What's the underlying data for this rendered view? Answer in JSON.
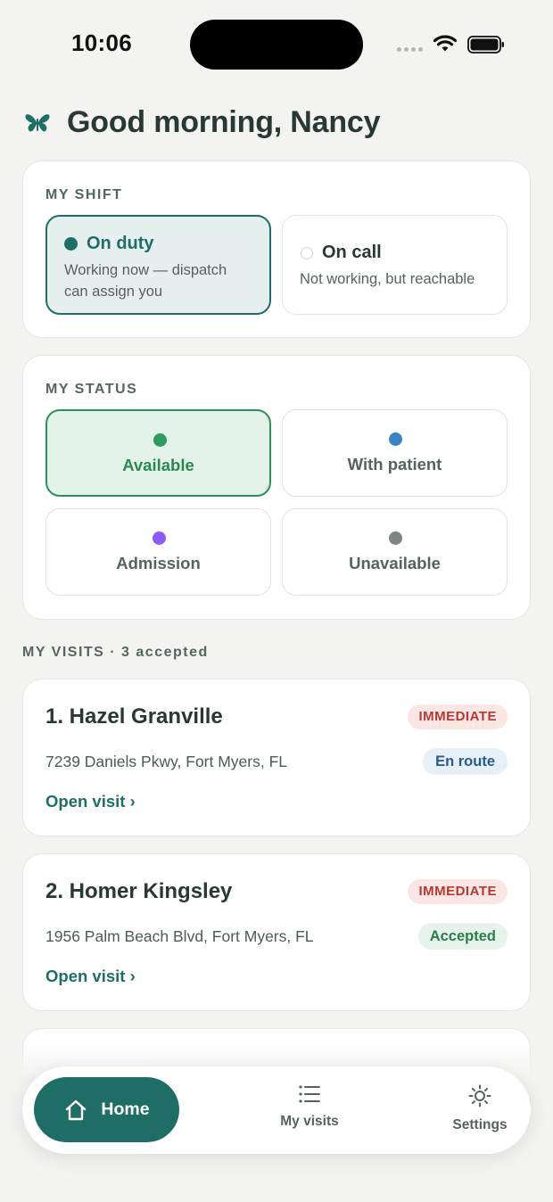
{
  "status_bar": {
    "time": "10:06"
  },
  "header": {
    "greeting": "Good morning, Nancy"
  },
  "shift": {
    "label": "MY SHIFT",
    "options": [
      {
        "title": "On duty",
        "subtitle_line1": "Working now — dispatch",
        "subtitle_line2": "can assign you",
        "selected": true
      },
      {
        "title": "On call",
        "subtitle_line1": "Not working, but reachable",
        "selected": false
      }
    ]
  },
  "status": {
    "label": "MY STATUS",
    "options": [
      {
        "label": "Available",
        "color": "#2e9a5c",
        "selected": true
      },
      {
        "label": "With patient",
        "color": "#3b82c4",
        "selected": false
      },
      {
        "label": "Admission",
        "color": "#8b5cf6",
        "selected": false
      },
      {
        "label": "Unavailable",
        "color": "#7d8583",
        "selected": false
      }
    ]
  },
  "visits": {
    "label": "MY VISITS · 3 accepted",
    "items": [
      {
        "name": "1. Hazel Granville",
        "priority": "IMMEDIATE",
        "address": "7239 Daniels Pkwy, Fort Myers, FL",
        "state": "En route",
        "link": "Open visit ›"
      },
      {
        "name": "2. Homer Kingsley",
        "priority": "IMMEDIATE",
        "address": "1956 Palm Beach Blvd, Fort Myers, FL",
        "state": "Accepted",
        "link": "Open visit ›"
      }
    ]
  },
  "nav": {
    "home": "Home",
    "visits": "My visits",
    "settings": "Settings"
  },
  "colors": {
    "accent": "#1f6e66",
    "background": "#f3f3f2"
  }
}
